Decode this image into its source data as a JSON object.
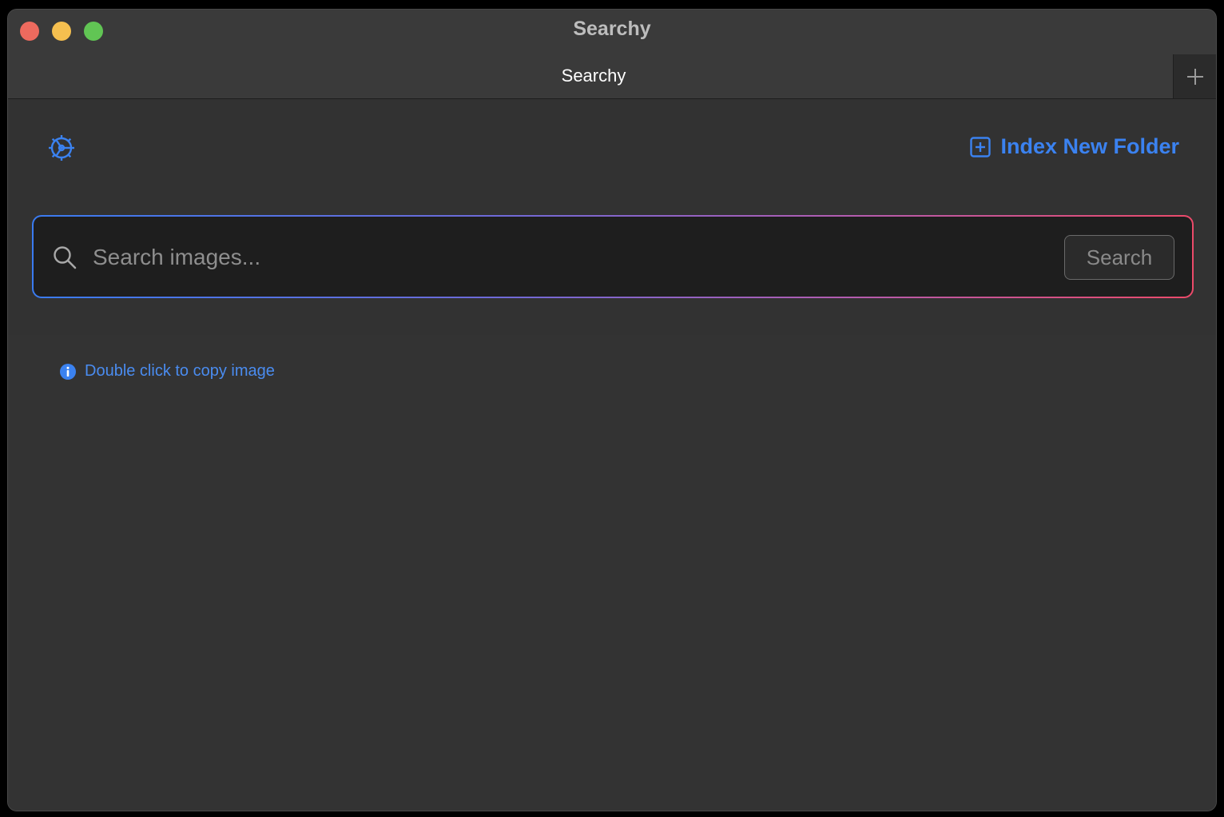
{
  "window": {
    "title": "Searchy"
  },
  "tabs": [
    {
      "label": "Searchy"
    }
  ],
  "toolbar": {
    "settings_icon": "gear-icon",
    "index_button_label": "Index New Folder",
    "index_button_icon": "plus-square-icon"
  },
  "search": {
    "placeholder": "Search images...",
    "value": "",
    "button_label": "Search"
  },
  "hint": {
    "text": "Double click to copy image",
    "icon": "info-icon"
  },
  "colors": {
    "accent": "#3b82f0",
    "gradient_start": "#3a7bf0",
    "gradient_end": "#ec4a6a",
    "background": "#323232"
  }
}
